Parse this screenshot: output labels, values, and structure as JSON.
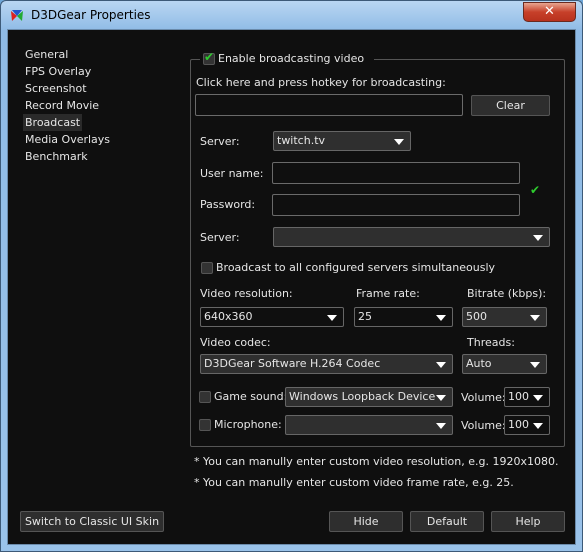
{
  "window": {
    "title": "D3DGear Properties",
    "close": "✕"
  },
  "sidebar": {
    "items": [
      {
        "label": "General"
      },
      {
        "label": "FPS Overlay"
      },
      {
        "label": "Screenshot"
      },
      {
        "label": "Record Movie"
      },
      {
        "label": "Broadcast",
        "selected": true
      },
      {
        "label": "Media Overlays"
      },
      {
        "label": "Benchmark"
      }
    ]
  },
  "broadcast": {
    "enable_label": "Enable broadcasting video",
    "enable_checked": true,
    "hotkey_label": "Click here and press hotkey for broadcasting:",
    "hotkey_value": "",
    "clear": "Clear",
    "server_label": "Server:",
    "server_value": "twitch.tv",
    "username_label": "User name:",
    "username_value": "",
    "password_label": "Password:",
    "password_value": "",
    "verified_icon": "✔",
    "server2_label": "Server:",
    "server2_value": "",
    "all_servers_label": "Broadcast to all configured servers simultaneously",
    "resolution_label": "Video resolution:",
    "resolution_value": "640x360",
    "framerate_label": "Frame rate:",
    "framerate_value": "25",
    "bitrate_label": "Bitrate (kbps):",
    "bitrate_value": "500",
    "codec_label": "Video codec:",
    "codec_value": "D3DGear Software H.264 Codec",
    "threads_label": "Threads:",
    "threads_value": "Auto",
    "game_sound_label": "Game sound:",
    "game_sound_device": "Windows Loopback Device",
    "game_volume_label": "Volume:",
    "game_volume": "100",
    "mic_label": "Microphone:",
    "mic_device": "",
    "mic_volume_label": "Volume:",
    "mic_volume": "100",
    "note1": "* You can manully enter custom video resolution, e.g. 1920x1080.",
    "note2": "* You can manully enter custom video frame rate, e.g. 25."
  },
  "footer": {
    "classic": "Switch to Classic UI Skin",
    "hide": "Hide",
    "default": "Default",
    "help": "Help"
  }
}
